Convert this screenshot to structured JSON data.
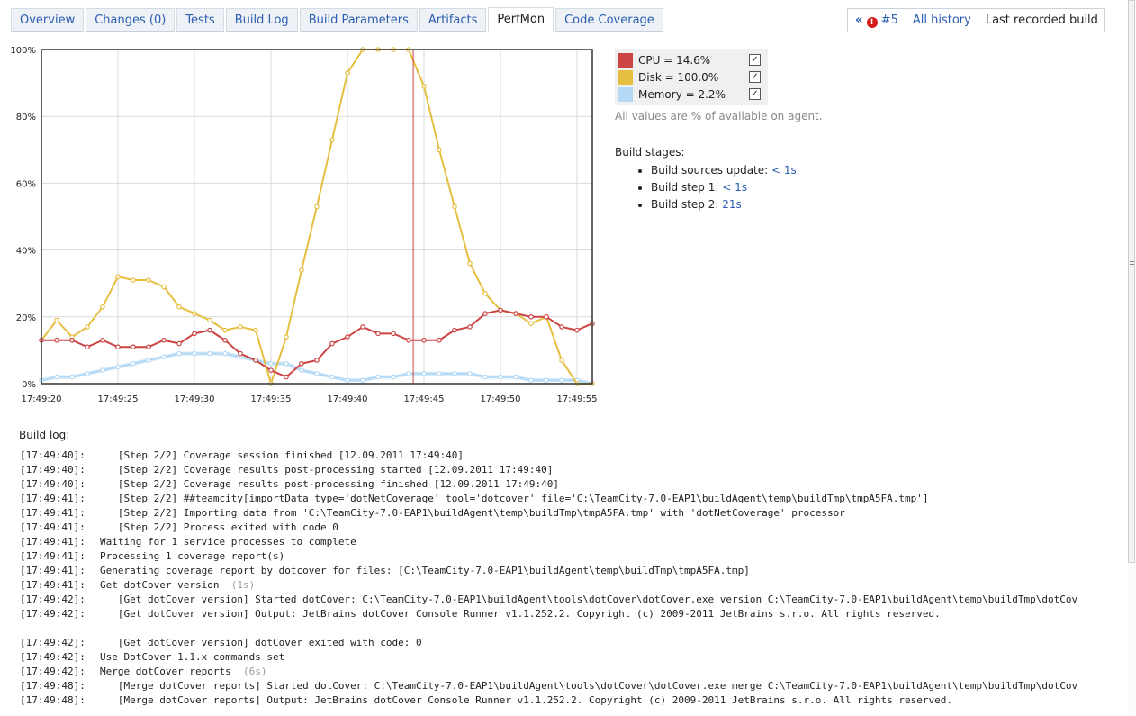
{
  "tabs": [
    {
      "label": "Overview",
      "selected": false
    },
    {
      "label": "Changes (0)",
      "selected": false
    },
    {
      "label": "Tests",
      "selected": false
    },
    {
      "label": "Build Log",
      "selected": false
    },
    {
      "label": "Build Parameters",
      "selected": false
    },
    {
      "label": "Artifacts",
      "selected": false
    },
    {
      "label": "PerfMon",
      "selected": true
    },
    {
      "label": "Code Coverage",
      "selected": false
    }
  ],
  "history": {
    "prev_icon": "double-chevron-left-icon",
    "error_icon": "error-icon",
    "build_number": "#5",
    "all_history": "All history",
    "last_recorded": "Last recorded build"
  },
  "legend": {
    "items": [
      {
        "label": "CPU = 14.6%",
        "color": "#cc4444",
        "checked": true
      },
      {
        "label": "Disk = 100.0%",
        "color": "#e6be40",
        "checked": true
      },
      {
        "label": "Memory = 2.2%",
        "color": "#b4d9f5",
        "checked": true
      }
    ],
    "note": "All values are % of available on agent."
  },
  "stages": {
    "title": "Build stages:",
    "items": [
      {
        "label": "Build sources update:",
        "duration": "< 1s"
      },
      {
        "label": "Build step 1:",
        "duration": "< 1s"
      },
      {
        "label": "Build step 2:",
        "duration": "21s"
      }
    ]
  },
  "chart_data": {
    "type": "line",
    "title": "",
    "xlabel": "",
    "ylabel": "",
    "x_ticks": [
      "17:49:20",
      "17:49:25",
      "17:49:30",
      "17:49:35",
      "17:49:40",
      "17:49:45",
      "17:49:50",
      "17:49:55"
    ],
    "y_ticks": [
      "0%",
      "20%",
      "40%",
      "60%",
      "80%",
      "100%"
    ],
    "ylim": [
      0,
      100
    ],
    "x_start_seconds": 20,
    "x_step_seconds": 1,
    "marker_x_seconds": 44.3,
    "grid": true,
    "series": [
      {
        "name": "CPU",
        "color": "#cc4444",
        "values": [
          13,
          13,
          13,
          11,
          13,
          11,
          11,
          11,
          13,
          12,
          15,
          16,
          13,
          9,
          7,
          4,
          2,
          6,
          7,
          12,
          14,
          17,
          15,
          15,
          13,
          13,
          13,
          16,
          17,
          21,
          22,
          21,
          20,
          20,
          17,
          16,
          18
        ]
      },
      {
        "name": "Disk",
        "color": "#e6be40",
        "values": [
          13,
          19,
          14,
          17,
          23,
          32,
          31,
          31,
          29,
          23,
          21,
          19,
          16,
          17,
          16,
          0,
          14,
          34,
          53,
          73,
          93,
          100,
          100,
          100,
          100,
          89,
          70,
          53,
          36,
          27,
          22,
          21,
          18,
          20,
          7,
          0,
          0
        ]
      },
      {
        "name": "Memory",
        "color": "#b4d9f5",
        "values": [
          1,
          2,
          2,
          3,
          4,
          5,
          6,
          7,
          8,
          9,
          9,
          9,
          9,
          8,
          7,
          6,
          6,
          4,
          3,
          2,
          1,
          1,
          2,
          2,
          3,
          3,
          3,
          3,
          3,
          2,
          2,
          2,
          1,
          1,
          1,
          1,
          0
        ]
      }
    ]
  },
  "log": {
    "title": "Build log:",
    "lines": [
      {
        "ts": "[17:49:40]:",
        "text": "   [Step 2/2] Coverage session finished [12.09.2011 17:49:40]"
      },
      {
        "ts": "[17:49:40]:",
        "text": "   [Step 2/2] Coverage results post-processing started [12.09.2011 17:49:40]"
      },
      {
        "ts": "[17:49:40]:",
        "text": "   [Step 2/2] Coverage results post-processing finished [12.09.2011 17:49:40]"
      },
      {
        "ts": "[17:49:41]:",
        "text": "   [Step 2/2] ##teamcity[importData type='dotNetCoverage' tool='dotcover' file='C:\\TeamCity-7.0-EAP1\\buildAgent\\temp\\buildTmp\\tmpA5FA.tmp']"
      },
      {
        "ts": "[17:49:41]:",
        "text": "   [Step 2/2] Importing data from 'C:\\TeamCity-7.0-EAP1\\buildAgent\\temp\\buildTmp\\tmpA5FA.tmp' with 'dotNetCoverage' processor"
      },
      {
        "ts": "[17:49:41]:",
        "text": "   [Step 2/2] Process exited with code 0"
      },
      {
        "ts": "[17:49:41]:",
        "text": "Waiting for 1 service processes to complete"
      },
      {
        "ts": "[17:49:41]:",
        "text": "Processing 1 coverage report(s)"
      },
      {
        "ts": "[17:49:41]:",
        "text": "Generating coverage report by dotcover for files: [C:\\TeamCity-7.0-EAP1\\buildAgent\\temp\\buildTmp\\tmpA5FA.tmp]"
      },
      {
        "ts": "[17:49:41]:",
        "text": "Get dotCover version",
        "dur": "(1s)"
      },
      {
        "ts": "[17:49:42]:",
        "text": "   [Get dotCover version] Started dotCover: C:\\TeamCity-7.0-EAP1\\buildAgent\\tools\\dotCover\\dotCover.exe version C:\\TeamCity-7.0-EAP1\\buildAgent\\temp\\buildTmp\\dotCov"
      },
      {
        "ts": "[17:49:42]:",
        "text": "   [Get dotCover version] Output: JetBrains dotCover Console Runner v1.1.252.2. Copyright (c) 2009-2011 JetBrains s.r.o. All rights reserved."
      },
      {
        "ts": "",
        "text": ""
      },
      {
        "ts": "[17:49:42]:",
        "text": "   [Get dotCover version] dotCover exited with code: 0"
      },
      {
        "ts": "[17:49:42]:",
        "text": "Use DotCover 1.1.x commands set"
      },
      {
        "ts": "[17:49:42]:",
        "text": "Merge dotCover reports",
        "dur": "(6s)"
      },
      {
        "ts": "[17:49:48]:",
        "text": "   [Merge dotCover reports] Started dotCover: C:\\TeamCity-7.0-EAP1\\buildAgent\\tools\\dotCover\\dotCover.exe merge C:\\TeamCity-7.0-EAP1\\buildAgent\\temp\\buildTmp\\dotCov"
      },
      {
        "ts": "[17:49:48]:",
        "text": "   [Merge dotCover reports] Output: JetBrains dotCover Console Runner v1.1.252.2. Copyright (c) 2009-2011 JetBrains s.r.o. All rights reserved."
      }
    ]
  }
}
